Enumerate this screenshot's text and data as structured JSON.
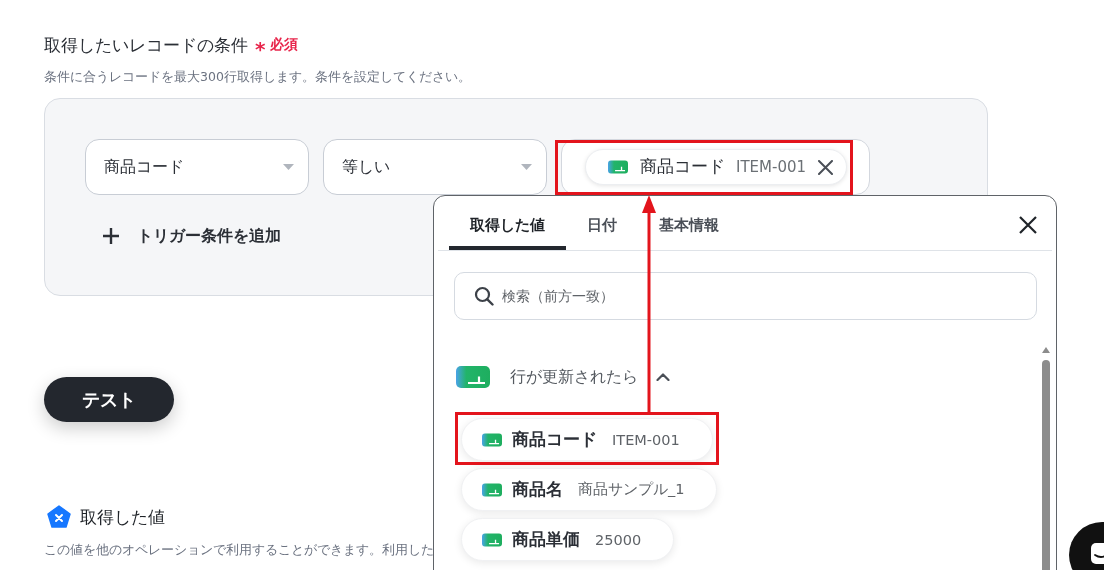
{
  "section": {
    "title": "取得したいレコードの条件",
    "required_mark": "*",
    "required_label": "必須",
    "description": "条件に合うレコードを最大300行取得します。条件を設定してください。"
  },
  "condition": {
    "field": "商品コード",
    "operator": "等しい",
    "value_chip": {
      "label": "商品コード",
      "value": "ITEM-001",
      "highlighted": true
    }
  },
  "add_condition": "トリガー条件を追加",
  "test_button": "テスト",
  "output": {
    "title": "取得した値",
    "description": "この値を他のオペレーションで利用することができます。利用した"
  },
  "popup": {
    "tabs": [
      {
        "label": "取得した値",
        "selected": true
      },
      {
        "label": "日付",
        "selected": false
      },
      {
        "label": "基本情報",
        "selected": false
      }
    ],
    "search": {
      "placeholder": "検索（前方一致）"
    },
    "group": {
      "title": "行が更新されたら",
      "expanded": true,
      "items": [
        {
          "label": "商品コード",
          "value": "ITEM-001",
          "highlighted": true
        },
        {
          "label": "商品名",
          "value": "商品サンプル_1",
          "highlighted": false
        },
        {
          "label": "商品単価",
          "value": "25000",
          "highlighted": false
        }
      ]
    }
  }
}
